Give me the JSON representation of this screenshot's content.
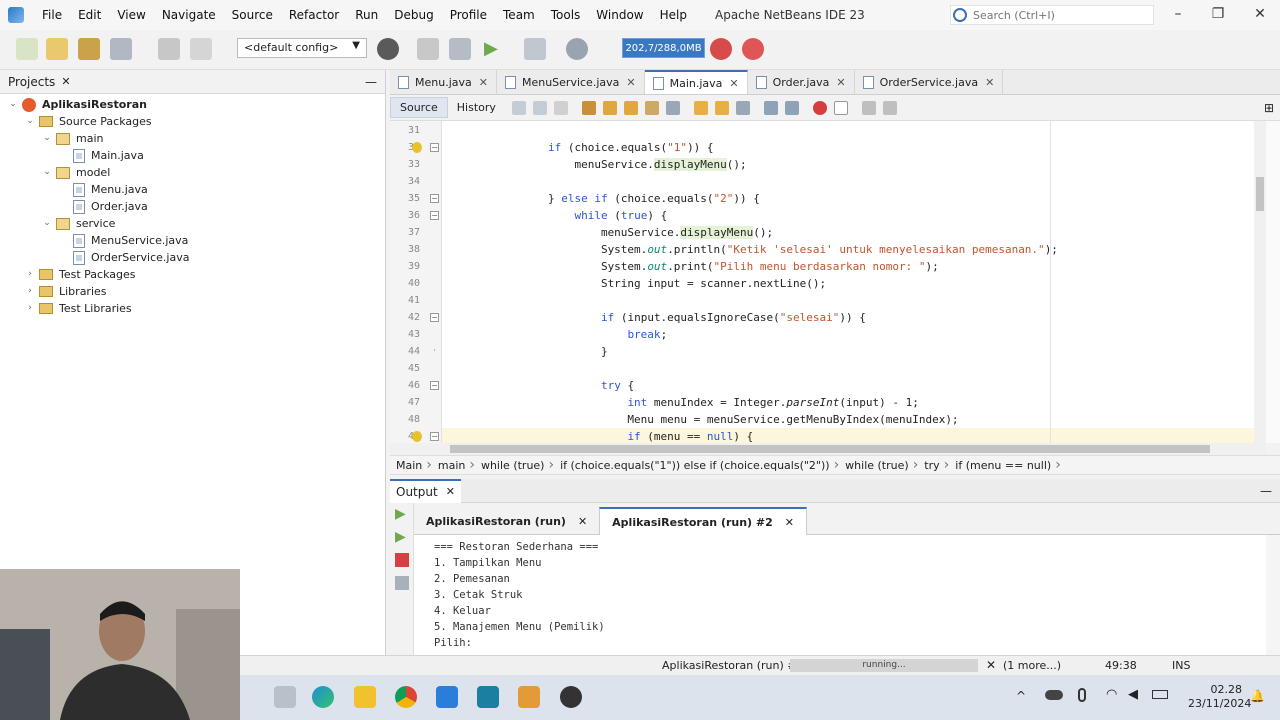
{
  "menubar": {
    "items": [
      "File",
      "Edit",
      "View",
      "Navigate",
      "Source",
      "Refactor",
      "Run",
      "Debug",
      "Profile",
      "Team",
      "Tools",
      "Window",
      "Help"
    ],
    "title": "Apache NetBeans IDE 23",
    "search_placeholder": "Search (Ctrl+I)"
  },
  "toolbar": {
    "config": "<default config>",
    "memory": "202,7/288,0MB"
  },
  "projects": {
    "tab": "Projects",
    "tree": [
      {
        "label": "AplikasiRestoran",
        "kind": "project",
        "depth": 0,
        "expand": "v"
      },
      {
        "label": "Source Packages",
        "kind": "folder",
        "depth": 1,
        "expand": "v"
      },
      {
        "label": "main",
        "kind": "package",
        "depth": 2,
        "expand": "v"
      },
      {
        "label": "Main.java",
        "kind": "file",
        "depth": 3,
        "expand": ""
      },
      {
        "label": "model",
        "kind": "package",
        "depth": 2,
        "expand": "v"
      },
      {
        "label": "Menu.java",
        "kind": "file",
        "depth": 3,
        "expand": ""
      },
      {
        "label": "Order.java",
        "kind": "file",
        "depth": 3,
        "expand": ""
      },
      {
        "label": "service",
        "kind": "package",
        "depth": 2,
        "expand": "v"
      },
      {
        "label": "MenuService.java",
        "kind": "file",
        "depth": 3,
        "expand": ""
      },
      {
        "label": "OrderService.java",
        "kind": "file",
        "depth": 3,
        "expand": ""
      },
      {
        "label": "Test Packages",
        "kind": "folder",
        "depth": 1,
        "expand": ">"
      },
      {
        "label": "Libraries",
        "kind": "folder",
        "depth": 1,
        "expand": ">"
      },
      {
        "label": "Test Libraries",
        "kind": "folder",
        "depth": 1,
        "expand": ">"
      }
    ]
  },
  "editor": {
    "tabs": [
      {
        "label": "Menu.java",
        "active": false
      },
      {
        "label": "MenuService.java",
        "active": false
      },
      {
        "label": "Main.java",
        "active": true
      },
      {
        "label": "Order.java",
        "active": false
      },
      {
        "label": "OrderService.java",
        "active": false
      }
    ],
    "source_label": "Source",
    "history_label": "History",
    "lines": [
      {
        "n": "31",
        "html": ""
      },
      {
        "n": "32",
        "html": "                <span class=\"kw\">if</span> (choice.equals(<span class=\"str\">\"1\"</span>)) {",
        "bulb": true,
        "fold": "-"
      },
      {
        "n": "33",
        "html": "                    menuService.<span class=\"fn\">displayMenu</span>();"
      },
      {
        "n": "34",
        "html": ""
      },
      {
        "n": "35",
        "html": "                } <span class=\"kw\">else if</span> (choice.equals(<span class=\"str\">\"2\"</span>)) {",
        "fold": "-"
      },
      {
        "n": "36",
        "html": "                    <span class=\"kw\">while</span> (<span class=\"kw\">true</span>) {",
        "fold": "-"
      },
      {
        "n": "37",
        "html": "                        menuService.<span class=\"fn\">displayMenu</span>();"
      },
      {
        "n": "38",
        "html": "                        System.<span class=\"out\">out</span>.println(<span class=\"str\">\"Ketik 'selesai' untuk menyelesaikan pemesanan.\"</span>);"
      },
      {
        "n": "39",
        "html": "                        System.<span class=\"out\">out</span>.print(<span class=\"str\">\"Pilih menu berdasarkan nomor: \"</span>);"
      },
      {
        "n": "40",
        "html": "                        String input = scanner.nextLine();"
      },
      {
        "n": "41",
        "html": ""
      },
      {
        "n": "42",
        "html": "                        <span class=\"kw\">if</span> (input.equalsIgnoreCase(<span class=\"str\">\"selesai\"</span>)) {",
        "fold": "-"
      },
      {
        "n": "43",
        "html": "                            <span class=\"kw\">break</span>;"
      },
      {
        "n": "44",
        "html": "                        }",
        "fold": "end"
      },
      {
        "n": "45",
        "html": ""
      },
      {
        "n": "46",
        "html": "                        <span class=\"kw\">try</span> {",
        "fold": "-"
      },
      {
        "n": "47",
        "html": "                            <span class=\"kw\">int</span> menuIndex = Integer.<span class=\"ital\">parseInt</span>(input) - 1;"
      },
      {
        "n": "48",
        "html": "                            Menu menu = menuService.getMenuByIndex(menuIndex);"
      },
      {
        "n": "49",
        "html": "                            <span class=\"kw\">if</span> (menu == <span class=\"kw\">null</span>) {",
        "bulb": true,
        "fold": "-",
        "hl": true
      }
    ]
  },
  "breadcrumb": [
    "Main",
    "main",
    "while (true)",
    "if (choice.equals(\"1\")) else if (choice.equals(\"2\"))",
    "while (true)",
    "try",
    "if (menu == null)"
  ],
  "output": {
    "tab": "Output",
    "run_tabs": [
      "AplikasiRestoran (run)",
      "AplikasiRestoran (run) #2"
    ],
    "lines": [
      "=== Restoran Sederhana ===",
      "1. Tampilkan Menu",
      "2. Pemesanan",
      "3. Cetak Struk",
      "4. Keluar",
      "5. Manajemen Menu (Pemilik)",
      "Pilih:"
    ]
  },
  "status": {
    "task": "AplikasiRestoran (run) #2",
    "progress": "running...",
    "more": "(1 more...)",
    "position": "49:38",
    "mode": "INS"
  },
  "taskbar": {
    "time": "02.28",
    "date": "23/11/2024"
  }
}
